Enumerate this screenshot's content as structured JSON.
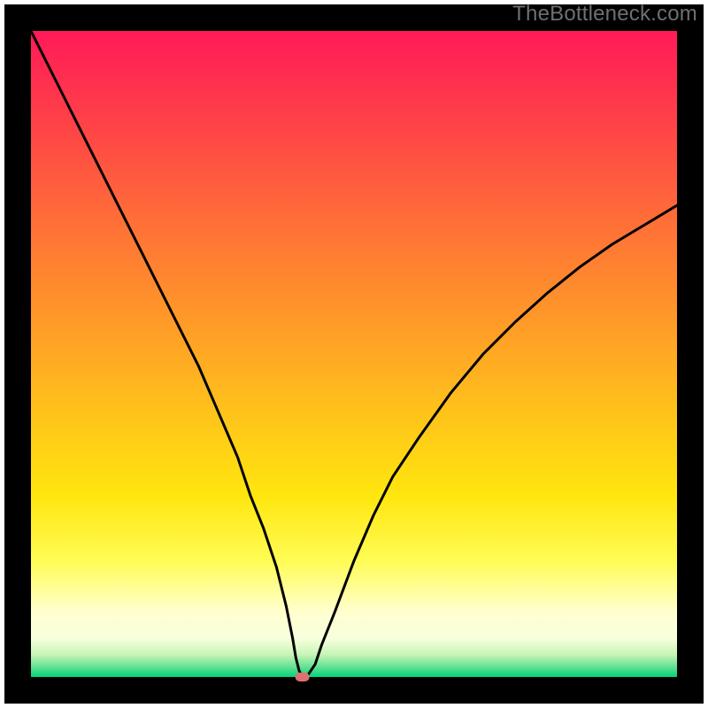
{
  "watermark": "TheBottleneck.com",
  "chart_data": {
    "type": "line",
    "title": "",
    "xlabel": "",
    "ylabel": "",
    "xlim": [
      0,
      100
    ],
    "ylim": [
      0,
      100
    ],
    "x": [
      0,
      2,
      5,
      8,
      11,
      14,
      17,
      20,
      23,
      26,
      29,
      32,
      34,
      36,
      38,
      39.5,
      40.5,
      41,
      41.5,
      42,
      42.5,
      43,
      44,
      45,
      47,
      50,
      53,
      56,
      60,
      65,
      70,
      75,
      80,
      85,
      90,
      95,
      100
    ],
    "values": [
      100,
      96,
      90,
      84,
      78,
      72,
      66,
      60,
      54,
      48,
      41,
      34,
      28,
      23,
      17,
      11,
      6,
      3,
      1,
      0,
      0,
      0.5,
      2,
      5,
      10,
      18,
      25,
      31,
      37,
      44,
      50,
      55,
      59.5,
      63.5,
      67,
      70,
      73
    ],
    "marker": {
      "x": 42,
      "y": 0,
      "color": "#e07070"
    },
    "background_gradient": {
      "stops": [
        {
          "offset": 0.0,
          "color": "#ff1a58"
        },
        {
          "offset": 0.15,
          "color": "#ff4447"
        },
        {
          "offset": 0.3,
          "color": "#ff7037"
        },
        {
          "offset": 0.45,
          "color": "#ff9a28"
        },
        {
          "offset": 0.6,
          "color": "#ffc51a"
        },
        {
          "offset": 0.72,
          "color": "#ffe60f"
        },
        {
          "offset": 0.82,
          "color": "#fffc55"
        },
        {
          "offset": 0.9,
          "color": "#ffffd0"
        },
        {
          "offset": 0.94,
          "color": "#f8ffdc"
        },
        {
          "offset": 0.965,
          "color": "#c8f5b8"
        },
        {
          "offset": 0.985,
          "color": "#60e090"
        },
        {
          "offset": 1.0,
          "color": "#00d37a"
        }
      ]
    },
    "border_color": "#000000",
    "axis_x": {
      "min": 0,
      "max": 100,
      "ticks": []
    },
    "axis_y": {
      "min": 0,
      "max": 100,
      "ticks": []
    }
  }
}
